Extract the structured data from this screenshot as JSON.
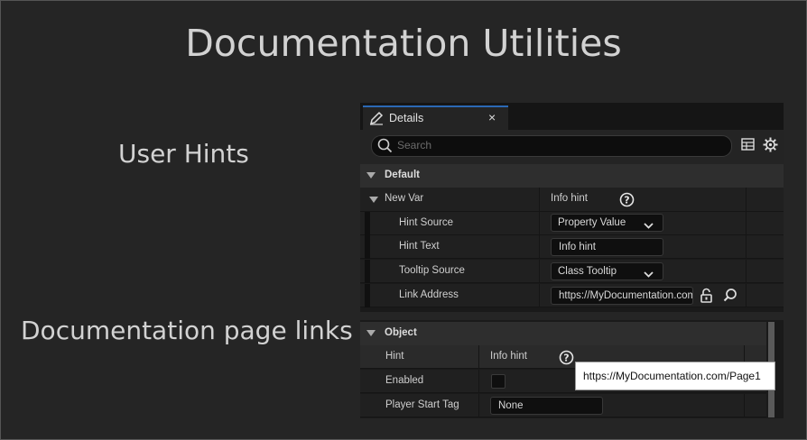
{
  "slide": {
    "title": "Documentation Utilities",
    "section_user_hints": "User Hints",
    "section_doc_links": "Documentation page links"
  },
  "details_panel": {
    "tab_label": "Details",
    "close_glyph": "×",
    "search_placeholder": "Search",
    "category_default": "Default",
    "new_var": {
      "label": "New Var",
      "value": "Info hint"
    },
    "rows": {
      "hint_source": {
        "label": "Hint Source",
        "value": "Property Value"
      },
      "hint_text": {
        "label": "Hint Text",
        "value": "Info hint"
      },
      "tooltip_source": {
        "label": "Tooltip Source",
        "value": "Class Tooltip"
      },
      "link_address": {
        "label": "Link Address",
        "value": "https://MyDocumentation.com/Page1"
      }
    }
  },
  "object_panel": {
    "category_object": "Object",
    "hint": {
      "label": "Hint",
      "value": "Info hint"
    },
    "enabled": {
      "label": "Enabled",
      "checked": false
    },
    "player_start_tag": {
      "label": "Player Start Tag",
      "value": "None"
    }
  },
  "tooltip": {
    "text": "https://MyDocumentation.com/Page1"
  },
  "icons": {
    "edit": "pencil-icon",
    "search": "search-icon",
    "table": "table-view-icon",
    "settings": "gear-icon",
    "help": "question-circle-icon",
    "lock": "unlock-icon",
    "browse": "magnifier-icon",
    "dropdown": "chevron-down-icon"
  },
  "colors": {
    "background": "#252525",
    "panel": "#1a1a1a",
    "accent_tab": "#2b69b5",
    "text": "#d2d2d2"
  }
}
